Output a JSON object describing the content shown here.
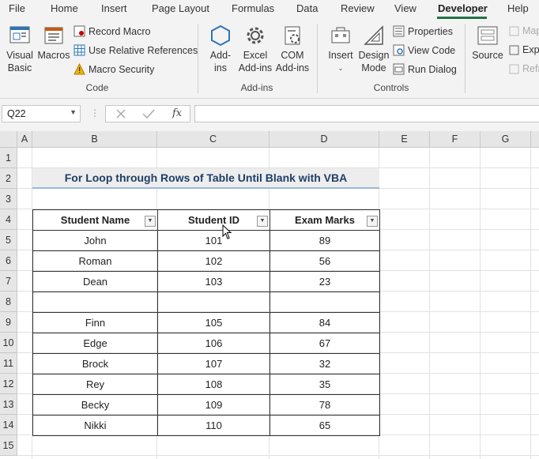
{
  "menu_tabs": [
    "File",
    "Home",
    "Insert",
    "Page Layout",
    "Formulas",
    "Data",
    "Review",
    "View",
    "Developer",
    "Help"
  ],
  "active_tab": "Developer",
  "ribbon": {
    "code": {
      "visual_basic": "Visual\nBasic",
      "macros": "Macros",
      "record_macro": "Record Macro",
      "relative_refs": "Use Relative References",
      "macro_security": "Macro Security",
      "label": "Code"
    },
    "addins": {
      "addins": "Add-\nins",
      "excel_addins": "Excel\nAdd-ins",
      "com_addins": "COM\nAdd-ins",
      "label": "Add-ins"
    },
    "controls": {
      "insert": "Insert",
      "design_mode": "Design\nMode",
      "properties": "Properties",
      "view_code": "View Code",
      "run_dialog": "Run Dialog",
      "label": "Controls"
    },
    "xml": {
      "source": "Source",
      "map": "Map",
      "expand": "Expa",
      "refresh": "Refr"
    }
  },
  "formula_bar": {
    "name_box": "Q22",
    "fx": "fx",
    "formula": ""
  },
  "grid": {
    "columns": [
      "A",
      "B",
      "C",
      "D",
      "E",
      "F",
      "G"
    ],
    "rows": [
      "1",
      "2",
      "3",
      "4",
      "5",
      "6",
      "7",
      "8",
      "9",
      "10",
      "11",
      "12",
      "13",
      "14",
      "15"
    ],
    "title": "For Loop through Rows of Table Until Blank with VBA"
  },
  "table": {
    "headers": [
      "Student Name",
      "Student ID",
      "Exam Marks"
    ],
    "rows": [
      [
        "John",
        "101",
        "89"
      ],
      [
        "Roman",
        "102",
        "56"
      ],
      [
        "Dean",
        "103",
        "23"
      ],
      [
        "",
        "",
        ""
      ],
      [
        "Finn",
        "105",
        "84"
      ],
      [
        "Edge",
        "106",
        "67"
      ],
      [
        "Brock",
        "107",
        "32"
      ],
      [
        "Rey",
        "108",
        "35"
      ],
      [
        "Becky",
        "109",
        "78"
      ],
      [
        "Nikki",
        "110",
        "65"
      ]
    ]
  },
  "colors": {
    "accent": "#217346",
    "title_text": "#1f3e66",
    "title_border": "#9bb8d6"
  }
}
